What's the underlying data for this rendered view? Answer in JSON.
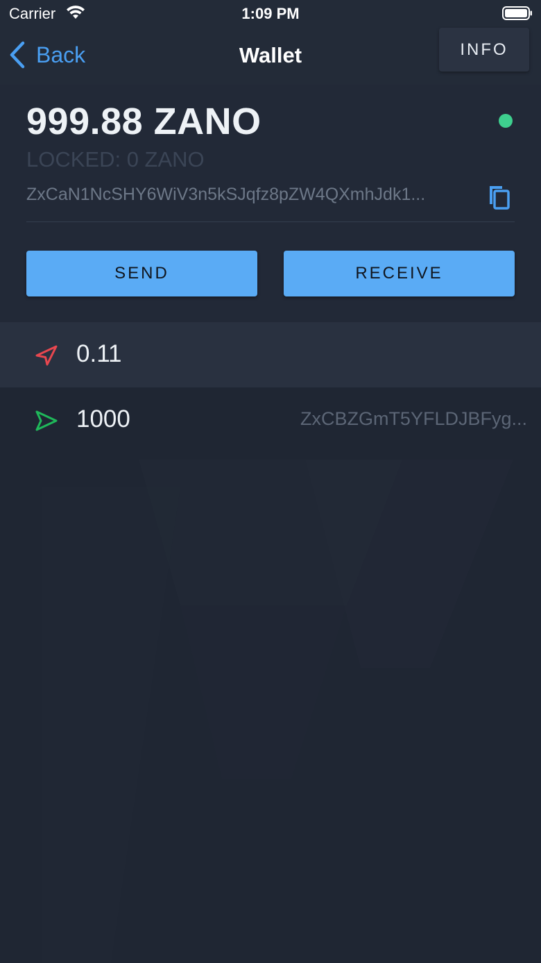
{
  "status_bar": {
    "carrier": "Carrier",
    "time": "1:09 PM",
    "wifi_icon": "wifi-icon",
    "battery_icon": "battery-full-icon"
  },
  "nav": {
    "back_label": "Back",
    "back_icon": "chevron-left-icon",
    "title": "Wallet",
    "info_label": "INFO"
  },
  "wallet": {
    "balance": "999.88 ZANO",
    "locked": "LOCKED: 0 ZANO",
    "address": "ZxCaN1NcSHY6WiV3n5kSJqfz8pZW4QXmhJdk1...",
    "sync_status_color": "#3ecf8e",
    "copy_icon": "copy-icon",
    "send_label": "SEND",
    "receive_label": "RECEIVE"
  },
  "transactions": [
    {
      "direction": "outgoing",
      "icon": "send-arrow-icon",
      "icon_color": "#e8474f",
      "amount": "0.11",
      "address": ""
    },
    {
      "direction": "incoming",
      "icon": "receive-arrow-icon",
      "icon_color": "#1fb85a",
      "amount": "1000",
      "address": "ZxCBZGmT5YFLDJBFyg..."
    }
  ],
  "colors": {
    "accent": "#5aabf5",
    "link": "#4a9ff2",
    "background": "#1f2633"
  }
}
